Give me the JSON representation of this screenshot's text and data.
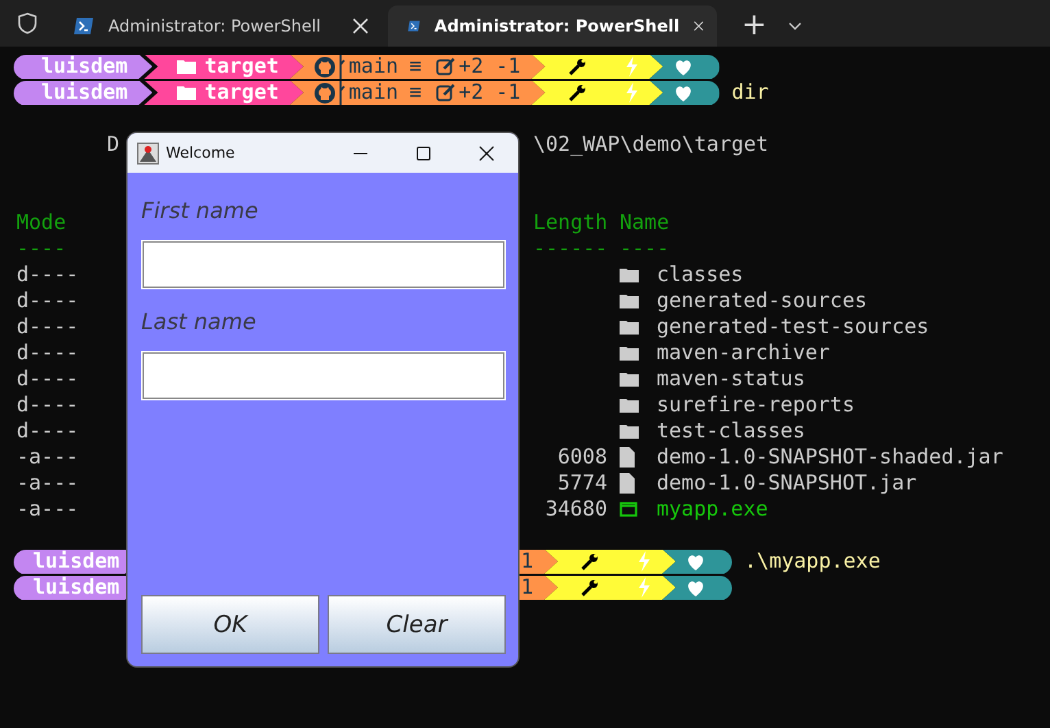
{
  "tabs": [
    {
      "title": "Administrator: PowerShell",
      "selected": false
    },
    {
      "title": "Administrator: PowerShell",
      "selected": true
    }
  ],
  "new_tab": "+",
  "prompts_top": [
    {
      "user": "luisdem",
      "path": "target",
      "branch": "main",
      "status": "≡",
      "changes": "+2 -1"
    },
    {
      "user": "luisdem",
      "path": "target",
      "branch": "main",
      "status": "≡",
      "changes": "+2 -1",
      "command": "dir"
    }
  ],
  "directory_line": {
    "left": "D",
    "right": "\\02_WAP\\demo\\target"
  },
  "listing": {
    "headers": {
      "mode": "Mode",
      "length": "Length",
      "name": "Name"
    },
    "rules": {
      "mode": "----",
      "length": "------",
      "name": "----"
    },
    "rows": [
      {
        "mode": "d----",
        "kind": "dir",
        "name": "classes"
      },
      {
        "mode": "d----",
        "kind": "dir",
        "name": "generated-sources"
      },
      {
        "mode": "d----",
        "kind": "dir",
        "name": "generated-test-sources"
      },
      {
        "mode": "d----",
        "kind": "dir",
        "name": "maven-archiver"
      },
      {
        "mode": "d----",
        "kind": "dir",
        "name": "maven-status"
      },
      {
        "mode": "d----",
        "kind": "dir",
        "name": "surefire-reports"
      },
      {
        "mode": "d----",
        "kind": "dir",
        "name": "test-classes"
      },
      {
        "mode": "-a---",
        "length": "6008",
        "kind": "file",
        "name": "demo-1.0-SNAPSHOT-shaded.jar"
      },
      {
        "mode": "-a---",
        "length": "5774",
        "kind": "file",
        "name": "demo-1.0-SNAPSHOT.jar"
      },
      {
        "mode": "-a---",
        "length": "34680",
        "kind": "exe",
        "name": "myapp.exe"
      }
    ]
  },
  "prompts_bottom": [
    {
      "user": "luisdem",
      "changes": "1",
      "command": ".\\myapp.exe"
    },
    {
      "user": "luisdem",
      "changes": "1"
    }
  ],
  "dialog": {
    "title": "Welcome",
    "fields": [
      {
        "label": "First name"
      },
      {
        "label": "Last name"
      }
    ],
    "buttons": [
      "OK",
      "Clear"
    ]
  }
}
